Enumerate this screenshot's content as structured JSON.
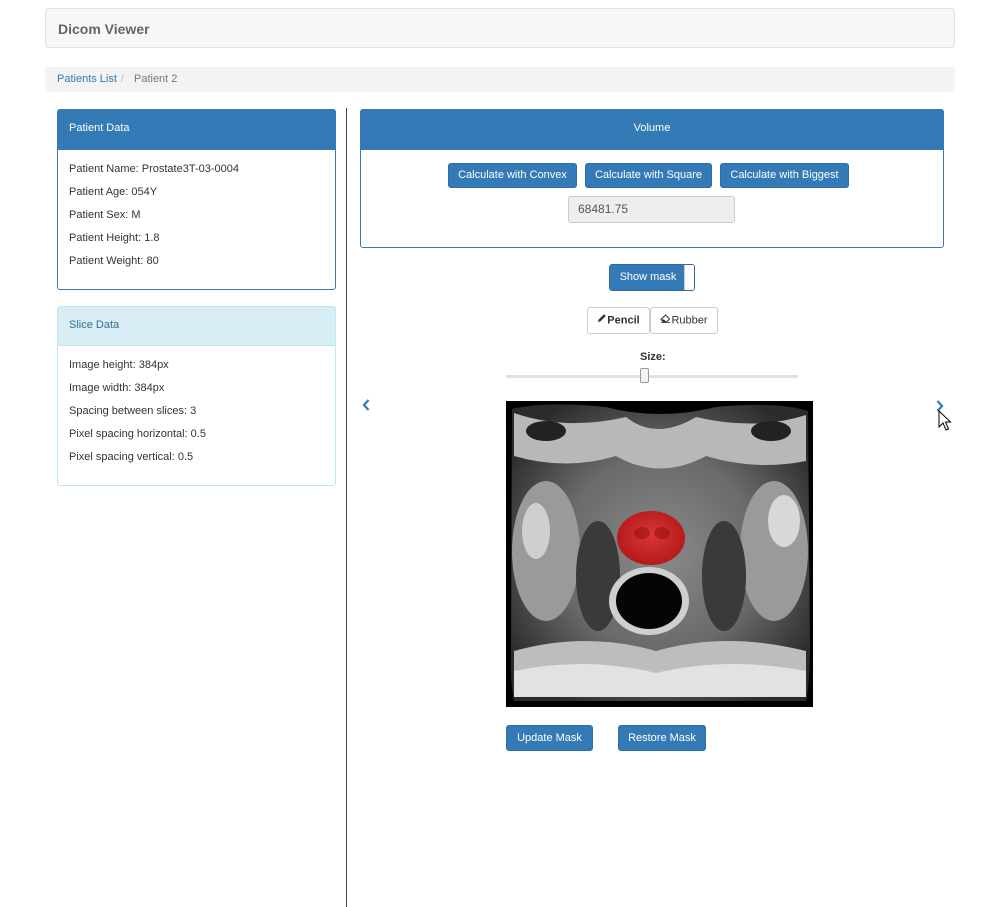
{
  "app": {
    "title": "Dicom Viewer"
  },
  "breadcrumb": {
    "link": "Patients List",
    "separator": "/",
    "current": "Patient 2"
  },
  "patient_panel": {
    "title": "Patient Data",
    "rows": [
      "Patient Name: Prostate3T-03-0004",
      "Patient Age: 054Y",
      "Patient Sex: M",
      "Patient Height: 1.8",
      "Patient Weight: 80"
    ]
  },
  "slice_panel": {
    "title": "Slice Data",
    "rows": [
      "Image height: 384px",
      "Image width: 384px",
      "Spacing between slices: 3",
      "Pixel spacing horizontal: 0.5",
      "Pixel spacing vertical: 0.5"
    ]
  },
  "volume_panel": {
    "title": "Volume",
    "buttons": {
      "convex": "Calculate with Convex",
      "square": "Calculate with Square",
      "biggest": "Calculate with Biggest"
    },
    "value": "68481.75"
  },
  "mask_toggle": {
    "label": "Show mask",
    "on": true
  },
  "tools": {
    "pencil": "Pencil",
    "rubber": "Rubber"
  },
  "size_slider": {
    "label": "Size:",
    "value_fraction": 0.47
  },
  "actions": {
    "update": "Update Mask",
    "restore": "Restore Mask"
  },
  "icons": {
    "prev": "chevron-left-icon",
    "next": "chevron-right-icon",
    "pencil": "pencil-icon",
    "rubber": "eraser-icon"
  },
  "colors": {
    "primary": "#337ab7",
    "mask": "#d01818",
    "info_bg": "#d9edf7"
  }
}
